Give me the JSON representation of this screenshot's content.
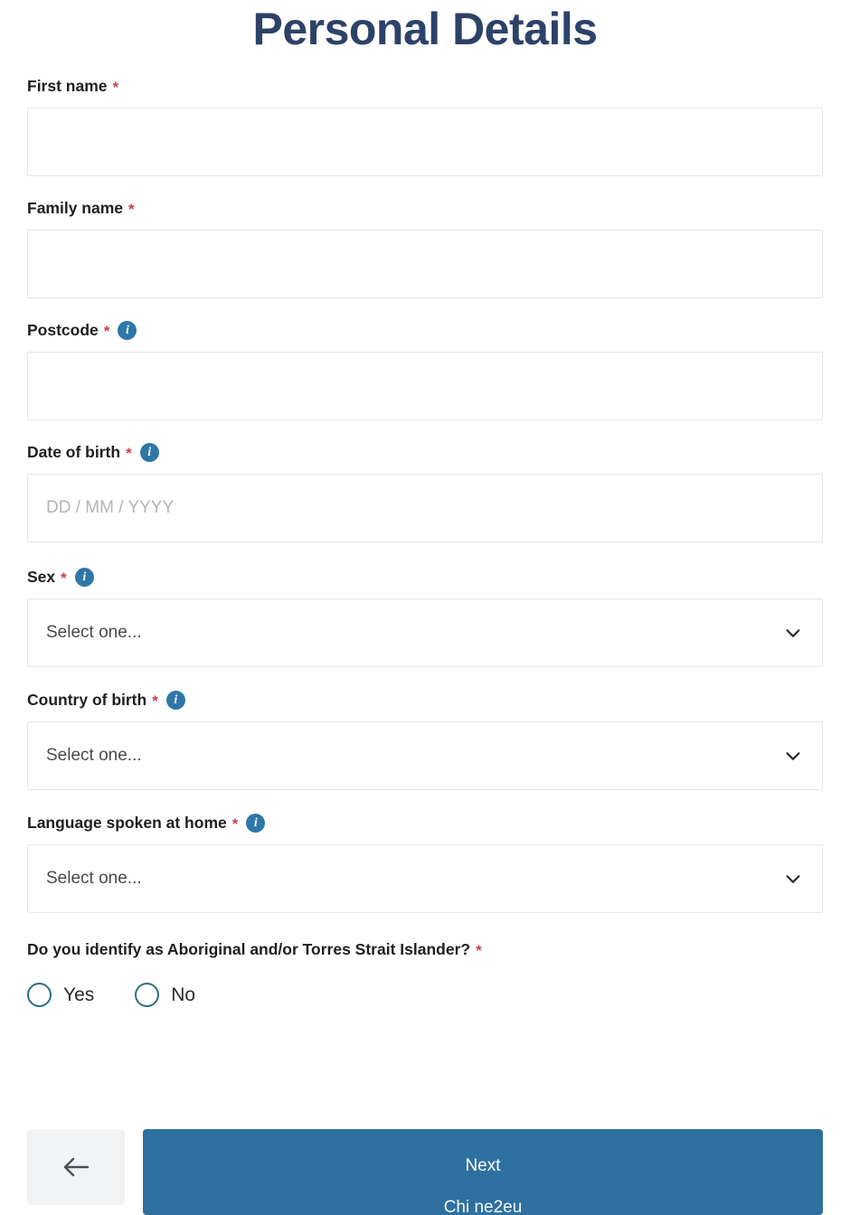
{
  "page": {
    "title": "Personal Details"
  },
  "fields": [
    {
      "label": "First name",
      "required": true,
      "has_info": false,
      "type": "text",
      "value": "",
      "placeholder": ""
    },
    {
      "label": "Family name",
      "required": true,
      "has_info": false,
      "type": "text",
      "value": "",
      "placeholder": ""
    },
    {
      "label": "Postcode",
      "required": true,
      "has_info": true,
      "type": "text",
      "value": "",
      "placeholder": ""
    },
    {
      "label": "Date of birth",
      "required": true,
      "has_info": true,
      "type": "text",
      "value": "",
      "placeholder": "DD / MM / YYYY"
    },
    {
      "label": "Sex",
      "required": true,
      "has_info": true,
      "type": "select",
      "value": "Select one..."
    },
    {
      "label": "Country of birth",
      "required": true,
      "has_info": true,
      "type": "select",
      "value": "Select one..."
    },
    {
      "label": "Language spoken at home",
      "required": true,
      "has_info": true,
      "type": "select",
      "value": "Select one..."
    }
  ],
  "radio_question": {
    "label": "Do you identify as Aboriginal and/or Torres Strait Islander?",
    "required": true,
    "options": [
      {
        "label": "Yes",
        "selected": false
      },
      {
        "label": "No",
        "selected": false
      }
    ]
  },
  "footer": {
    "back_label": "",
    "back_icon": "arrow-left-icon",
    "next_label": "Next",
    "next_sublabel": "Chi ne2eu"
  },
  "symbols": {
    "required_marker": "*",
    "info_glyph": "i",
    "select_placeholder": "Select one..."
  },
  "colors": {
    "title": "#2d4268",
    "required_star": "#c9424a",
    "info_icon_bg": "#2e77a8",
    "next_button_bg": "#2e709f",
    "back_button_bg": "#f2f3f5",
    "radio_border": "#2c6e7f",
    "input_border": "#e6e6e6"
  }
}
